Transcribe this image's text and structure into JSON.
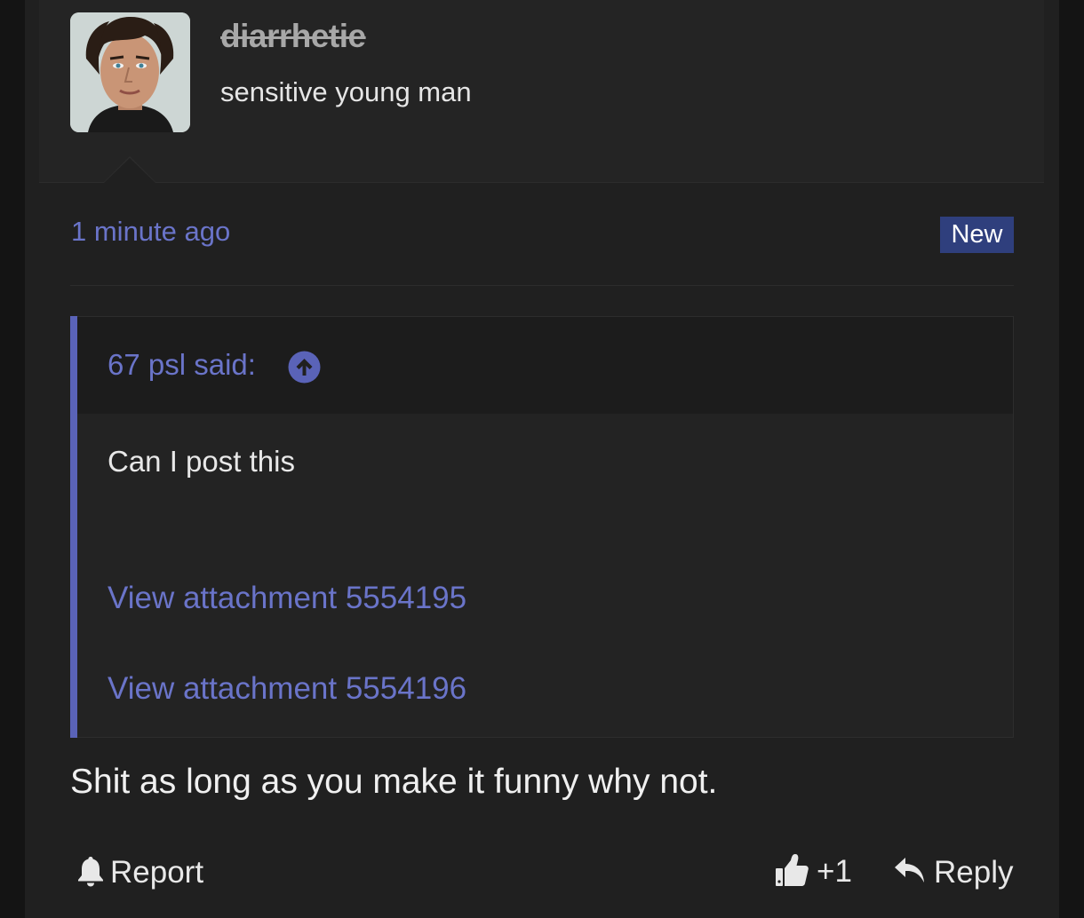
{
  "post": {
    "author": {
      "username": "diarrhetie",
      "title": "sensitive young man"
    },
    "timestamp": "1 minute ago",
    "badge": "New",
    "quote": {
      "author": "67 psl said:",
      "text": "Can I post this",
      "attachments": [
        "View attachment 5554195",
        "View attachment 5554196"
      ]
    },
    "body": "Shit as long as you make it funny why not.",
    "actions": {
      "report_label": "Report",
      "reaction_count": "+1",
      "reply_label": "Reply"
    }
  },
  "icons": {
    "report": "bell-icon",
    "reaction": "thumbs-up-icon",
    "reply": "reply-arrow-icon",
    "quote_jump": "arrow-up-circle-icon"
  },
  "colors": {
    "accent": "#6a74c9",
    "badge_bg": "#2f3f7d",
    "quote_bar": "#5a63b8",
    "background": "#202020"
  }
}
